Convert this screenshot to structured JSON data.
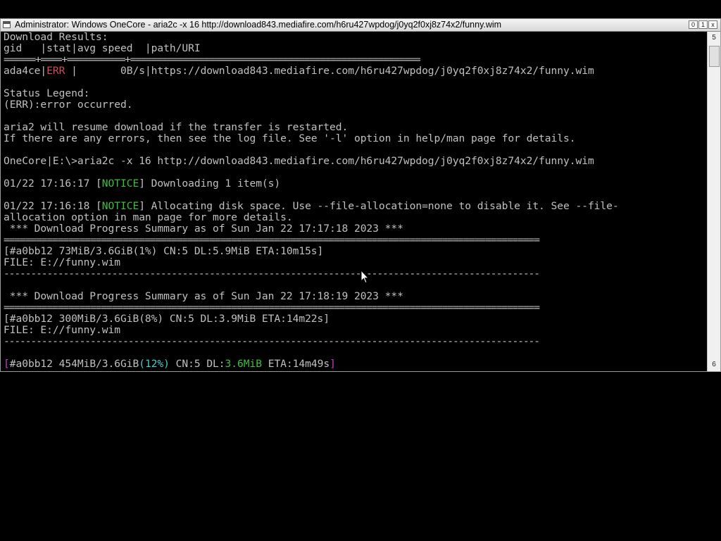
{
  "window": {
    "title": "Administrator:  Windows OneCore - aria2c  -x 16 http://download843.mediafire.com/h6ru427wpdog/j0yq2f0xj8z74x2/funny.wim",
    "buttons": [
      "0",
      "1",
      "x"
    ]
  },
  "scrollbar": {
    "up_glyph": "5",
    "down_glyph": "6"
  },
  "console": {
    "l1": "Download Results:",
    "l2": "gid   |stat|avg speed  |path/URI",
    "l3": "======+====+===========+=======================================================",
    "l4a": "ada4ce|",
    "l4b": "ERR",
    "l4c": " |       0B/s|https://download843.mediafire.com/h6ru427wpdog/j0yq2f0xj8z74x2/funny.wim",
    "l6": "Status Legend:",
    "l7": "(ERR):error occurred.",
    "l9": "aria2 will resume download if the transfer is restarted.",
    "l10": "If there are any errors, then see the log file. See '-l' option in help/man page for details.",
    "l12": "OneCore|E:\\>aria2c -x 16 http://download843.mediafire.com/h6ru427wpdog/j0yq2f0xj8z74x2/funny.wim",
    "l14a": "01/22 17:16:17 [",
    "l14b": "NOTICE",
    "l14c": "] Downloading 1 item(s)",
    "l16a": "01/22 17:16:18 [",
    "l16b": "NOTICE",
    "l16c": "] Allocating disk space. Use --file-allocation=none to disable it. See --file-",
    "l17": "allocation option in man page for more details.",
    "l18": " *** Download Progress Summary as of Sun Jan 22 17:17:18 2023 ***",
    "l19": "===================================================================================================",
    "l20": "[#a0bb12 73MiB/3.6GiB(1%) CN:5 DL:5.9MiB ETA:10m15s]",
    "l21": "FILE: E://funny.wim",
    "l22": "---------------------------------------------------------------------------------------------------",
    "l24": " *** Download Progress Summary as of Sun Jan 22 17:18:19 2023 ***",
    "l25": "===================================================================================================",
    "l26": "[#a0bb12 300MiB/3.6GiB(8%) CN:5 DL:3.9MiB ETA:14m22s]",
    "l27": "FILE: E://funny.wim",
    "l28": "---------------------------------------------------------------------------------------------------",
    "l30_open": "[",
    "l30_gid": "#a0bb12 454MiB/3.6GiB",
    "l30_pct": "(12%)",
    "l30_cn": " CN:5 DL:",
    "l30_dl": "3.6MiB",
    "l30_eta": " ETA:14m49s",
    "l30_close": "]"
  },
  "colors": {
    "error": "#d0505a",
    "notice": "#3fbf3f",
    "bracket": "#c040c0",
    "percent": "#4ec9c9",
    "text": "#c0c0c0",
    "background": "#000000"
  }
}
